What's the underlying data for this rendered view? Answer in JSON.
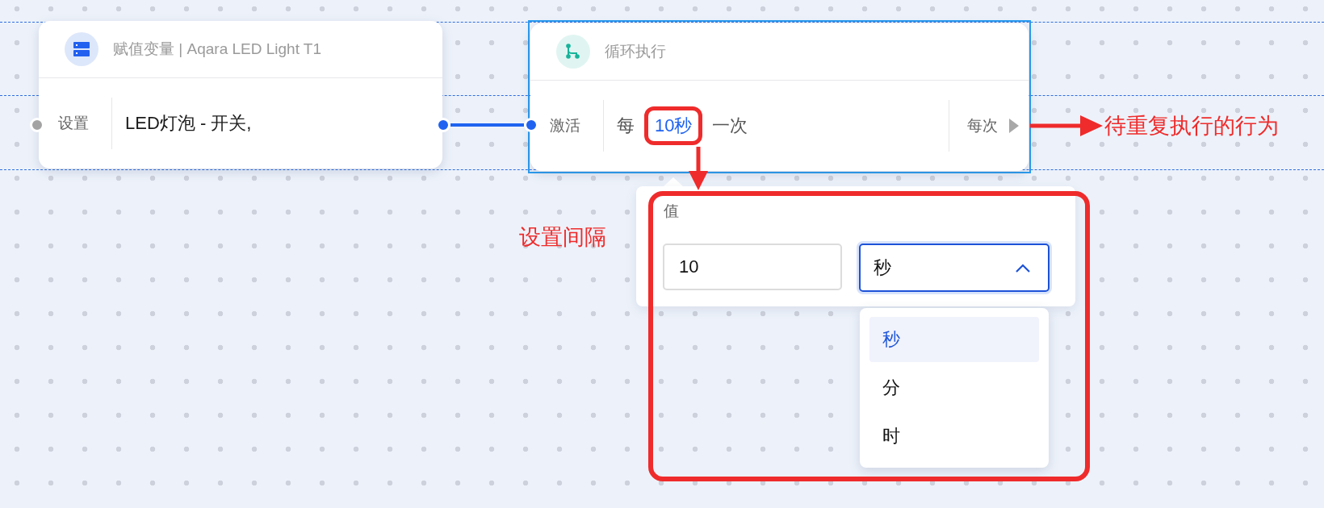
{
  "nodes": [
    {
      "title": "赋值变量 | Aqara LED Light T1",
      "selected": false,
      "label": "设置",
      "content": [
        {
          "kind": "text",
          "text": "LED灯泡 - 开关,"
        }
      ]
    },
    {
      "title": "循环执行",
      "selected": true,
      "label": "激活",
      "content": [
        {
          "kind": "text",
          "text": "每"
        },
        {
          "kind": "value",
          "text": "10秒"
        },
        {
          "kind": "text",
          "text": "一次"
        }
      ],
      "output_label": "每次"
    }
  ],
  "popover": {
    "label": "值",
    "value": "10",
    "unit": {
      "value": "秒",
      "expanded": true
    },
    "options": [
      {
        "label": "秒",
        "selected": true
      },
      {
        "label": "分",
        "selected": false
      },
      {
        "label": "时",
        "selected": false
      }
    ]
  },
  "annotations": [
    {
      "text": "设置间隔"
    },
    {
      "text": "待重复执行的行为"
    }
  ]
}
